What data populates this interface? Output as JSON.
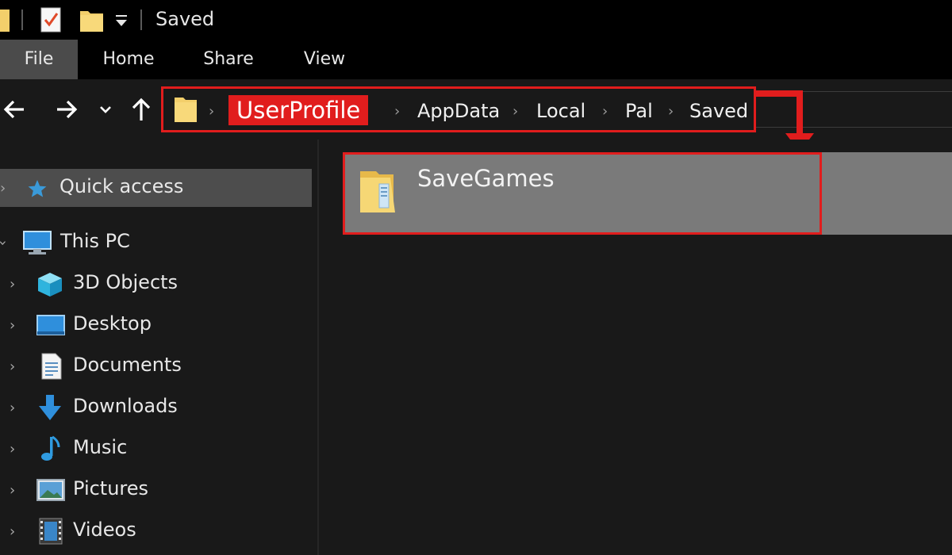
{
  "window": {
    "title": "Saved"
  },
  "ribbon": {
    "tabs": [
      {
        "label": "File",
        "active": true
      },
      {
        "label": "Home",
        "active": false
      },
      {
        "label": "Share",
        "active": false
      },
      {
        "label": "View",
        "active": false
      }
    ]
  },
  "nav": {
    "back": "back-arrow-icon",
    "forward": "forward-arrow-icon",
    "recent": "chevron-down-icon",
    "up": "up-arrow-icon"
  },
  "address": {
    "crumbs": [
      "UserProfile",
      "AppData",
      "Local",
      "Pal",
      "Saved"
    ],
    "highlighted": "UserProfile"
  },
  "sidebar": {
    "quick_access": "Quick access",
    "this_pc": "This PC",
    "items": [
      {
        "label": "3D Objects",
        "icon": "3d-objects-icon"
      },
      {
        "label": "Desktop",
        "icon": "desktop-icon"
      },
      {
        "label": "Documents",
        "icon": "documents-icon"
      },
      {
        "label": "Downloads",
        "icon": "downloads-icon"
      },
      {
        "label": "Music",
        "icon": "music-icon"
      },
      {
        "label": "Pictures",
        "icon": "pictures-icon"
      },
      {
        "label": "Videos",
        "icon": "videos-icon"
      }
    ]
  },
  "content": {
    "items": [
      {
        "label": "SaveGames",
        "icon": "folder-icon",
        "selected": true
      }
    ]
  },
  "colors": {
    "highlight_red": "#e11d1d",
    "folder_yellow": "#f3cf6b",
    "selection_gray": "#7a7a7a",
    "active_tab": "#4b4b4b"
  }
}
